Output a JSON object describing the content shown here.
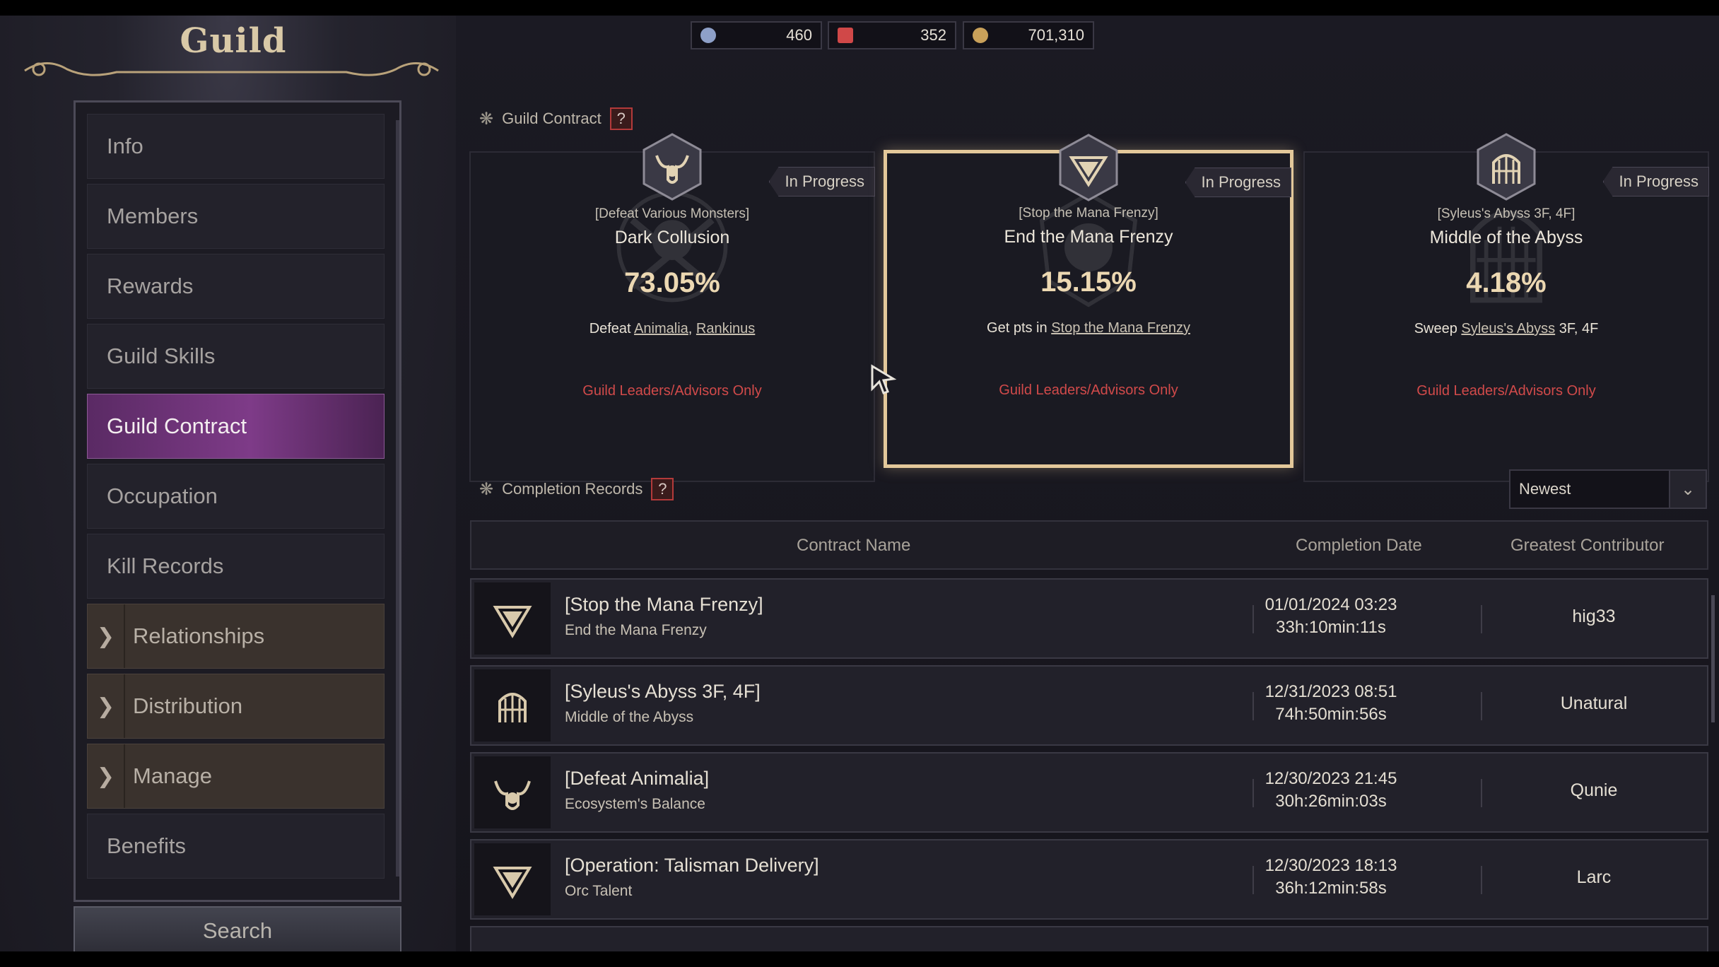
{
  "title": "Guild",
  "currencies": [
    {
      "icon": "crystal-icon",
      "value": "460",
      "color": "#8ea0c8"
    },
    {
      "icon": "ticket-icon",
      "value": "352",
      "color": "#d04848"
    },
    {
      "icon": "gold-coin-icon",
      "value": "701,310",
      "color": "#c9a15a"
    }
  ],
  "menu": {
    "items": [
      {
        "label": "Info"
      },
      {
        "label": "Members"
      },
      {
        "label": "Rewards"
      },
      {
        "label": "Guild Skills"
      },
      {
        "label": "Guild Contract"
      },
      {
        "label": "Occupation"
      },
      {
        "label": "Kill Records"
      },
      {
        "label": "Relationships"
      },
      {
        "label": "Distribution"
      },
      {
        "label": "Manage"
      },
      {
        "label": "Benefits"
      }
    ],
    "search_label": "Search"
  },
  "contract_section": {
    "title": "Guild Contract",
    "help": "?"
  },
  "contracts": [
    {
      "category": "[Defeat Various Monsters]",
      "name": "Dark Collusion",
      "progress_pct": "73.05%",
      "progress_value": 73.05,
      "desc_prefix": "Defeat ",
      "desc_link1": "Animalia",
      "desc_mid": ", ",
      "desc_link2": "Rankinus",
      "desc_suffix": "",
      "restriction": "Guild Leaders/Advisors Only",
      "status": "In Progress",
      "icon": "bull-skull-icon"
    },
    {
      "category": "[Stop the Mana Frenzy]",
      "name": "End the Mana Frenzy",
      "progress_pct": "15.15%",
      "progress_value": 15.15,
      "desc_prefix": "Get pts in ",
      "desc_link1": "Stop the Mana Frenzy",
      "desc_mid": "",
      "desc_link2": "",
      "desc_suffix": "",
      "restriction": "Guild Leaders/Advisors Only",
      "status": "In Progress",
      "icon": "triangle-gem-icon"
    },
    {
      "category": "[Syleus's Abyss 3F, 4F]",
      "name": "Middle of the Abyss",
      "progress_pct": "4.18%",
      "progress_value": 4.18,
      "desc_prefix": "Sweep ",
      "desc_link1": "Syleus's Abyss",
      "desc_mid": "",
      "desc_link2": "",
      "desc_suffix": " 3F, 4F",
      "restriction": "Guild Leaders/Advisors Only",
      "status": "In Progress",
      "icon": "gate-icon"
    }
  ],
  "records_section": {
    "title": "Completion Records",
    "help": "?",
    "sort": "Newest"
  },
  "table": {
    "headers": {
      "name": "Contract Name",
      "date": "Completion Date",
      "contributor": "Greatest Contributor"
    },
    "rows": [
      {
        "title": "[Stop the Mana Frenzy]",
        "sub": "End the Mana Frenzy",
        "date": "01/01/2024 03:23",
        "duration": "33h:10min:11s",
        "contributor": "hig33",
        "icon": "triangle-gem-icon"
      },
      {
        "title": "[Syleus's Abyss 3F, 4F]",
        "sub": "Middle of the Abyss",
        "date": "12/31/2023 08:51",
        "duration": "74h:50min:56s",
        "contributor": "Unatural",
        "icon": "gate-icon"
      },
      {
        "title": "[Defeat Animalia]",
        "sub": "Ecosystem's Balance",
        "date": "12/30/2023 21:45",
        "duration": "30h:26min:03s",
        "contributor": "Qunie",
        "icon": "bull-skull-icon"
      },
      {
        "title": "[Operation: Talisman Delivery]",
        "sub": "Orc Talent",
        "date": "12/30/2023 18:13",
        "duration": "36h:12min:58s",
        "contributor": "Larc",
        "icon": "triangle-gem-icon"
      }
    ]
  },
  "colors": {
    "accent_gold": "#e3c89a",
    "active_menu": "#7e3b88",
    "restriction_red": "#d14a4a"
  }
}
